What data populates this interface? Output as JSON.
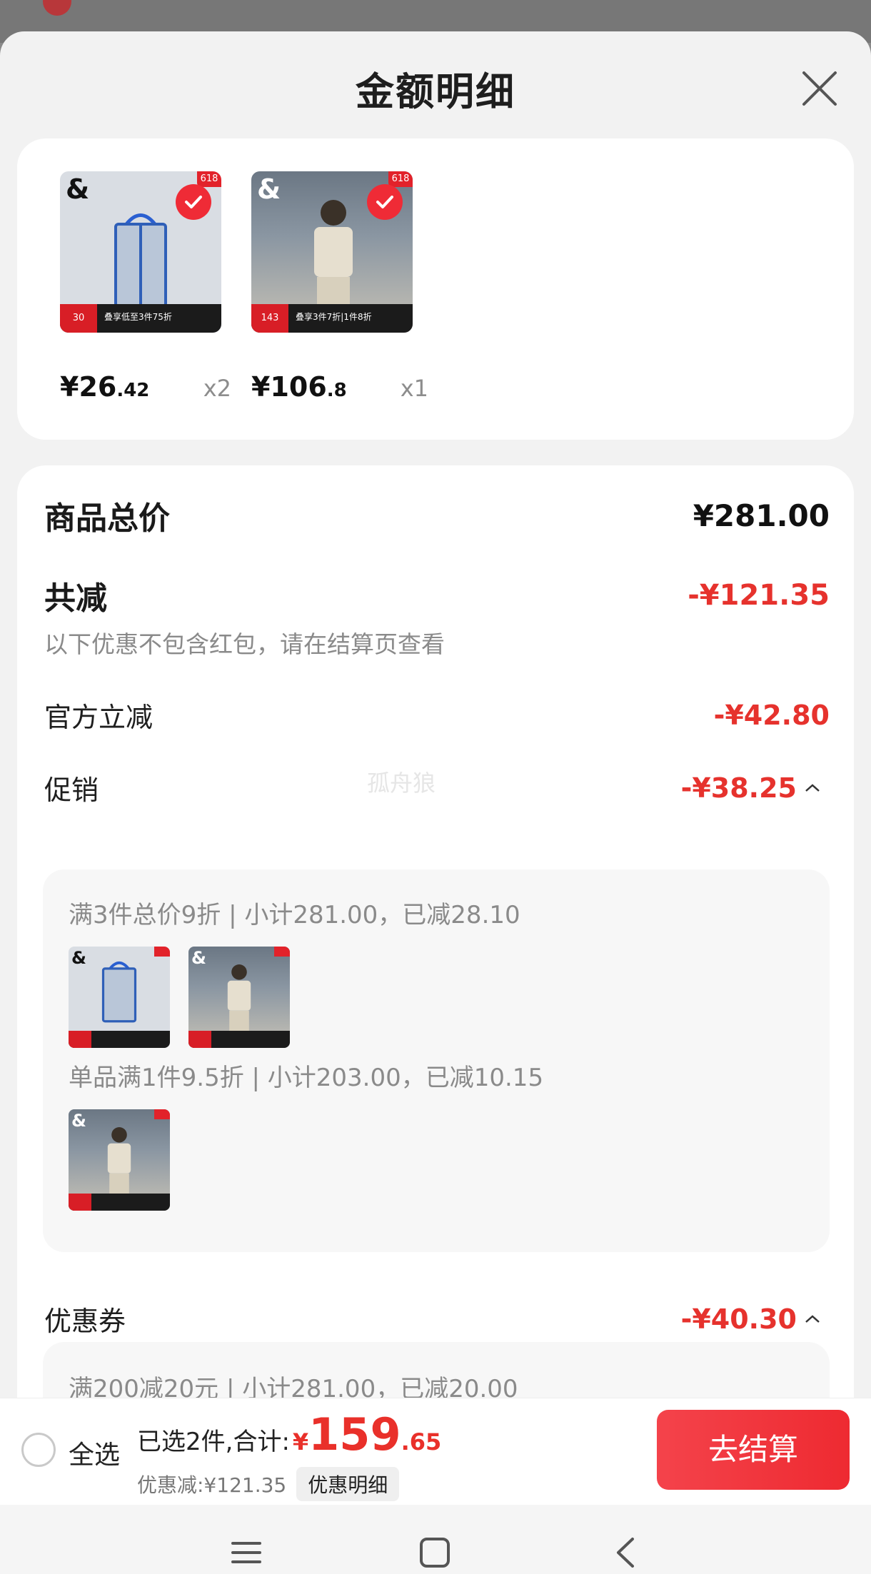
{
  "sheet": {
    "title": "金额明细"
  },
  "products": [
    {
      "brand": "&",
      "badge": "618",
      "promo": "叠享低至3件75折",
      "price_int": "¥26",
      "price_dec": ".42",
      "qty": "x2",
      "corner": "30"
    },
    {
      "brand": "&",
      "badge": "618",
      "promo": "叠享3件7折|1件8折",
      "price_int": "¥106",
      "price_dec": ".8",
      "qty": "x1",
      "corner": "143"
    }
  ],
  "breakdown": {
    "total_label": "商品总价",
    "total_value": "¥281.00",
    "reduce_label": "共减",
    "reduce_value": "-¥121.35",
    "reduce_note": "以下优惠不包含红包，请在结算页查看",
    "official_label": "官方立减",
    "official_value": "-¥42.80",
    "watermark": "孤舟狼",
    "promo_label": "促销",
    "promo_value": "-¥38.25",
    "promo_items": [
      {
        "text": "满3件总价9折 | 小计281.00，已减28.10"
      },
      {
        "text": "单品满1件9.5折 | 小计203.00，已减10.15"
      }
    ],
    "coupon_label": "优惠券",
    "coupon_value": "-¥40.30",
    "coupon_items": [
      {
        "text": "满200减20元 | 小计281.00，已减20.00"
      }
    ]
  },
  "bottom": {
    "select_all": "全选",
    "selected_prefix": "已选2件,合计:",
    "yen": "¥",
    "total_int": "159",
    "total_dec": ".65",
    "discount": "优惠减:¥121.35",
    "detail_btn": "优惠明细",
    "checkout": "去结算"
  },
  "colors": {
    "accent_red": "#e6322d",
    "checkout": "#ee2a31"
  },
  "icons": {
    "close": "close-icon",
    "check": "check-icon",
    "chevron": "chevron-up-icon",
    "nav_menu": "menu-icon",
    "nav_home": "home-icon",
    "nav_back": "back-icon"
  }
}
